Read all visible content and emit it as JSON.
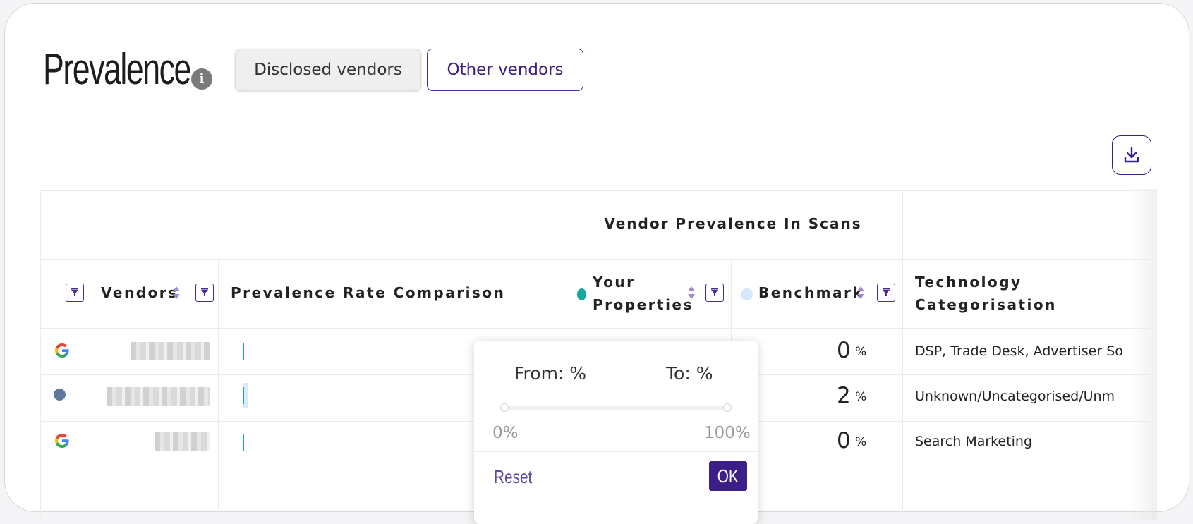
{
  "page": {
    "title": "Prevalence",
    "tabs": [
      {
        "label": "Disclosed vendors",
        "active": false
      },
      {
        "label": "Other vendors",
        "active": true
      }
    ]
  },
  "icons": {
    "info": "info-icon",
    "download": "download-icon",
    "filter": "filter-icon",
    "sort": "sort-icon"
  },
  "colors": {
    "accent": "#3b1e88",
    "your_properties": "#17a89f",
    "benchmark": "#d6e8fb"
  },
  "table": {
    "group_header": "Vendor Prevalence In Scans",
    "columns": {
      "vendors": "Vendors",
      "comparison": "Prevalence Rate Comparison",
      "your_properties": "Your Properties",
      "benchmark": "Benchmark",
      "technology": "Technology Categorisation"
    },
    "rows": [
      {
        "logo": "google-logo",
        "benchmark_value": "0",
        "benchmark_unit": "%",
        "technology": "DSP, Trade Desk, Advertiser So"
      },
      {
        "logo": "dot-logo",
        "benchmark_value": "2",
        "benchmark_unit": "%",
        "technology": "Unknown/Uncategorised/Unm"
      },
      {
        "logo": "google-logo",
        "benchmark_value": "0",
        "benchmark_unit": "%",
        "technology": "Search Marketing"
      }
    ]
  },
  "range_popup": {
    "from_label": "From: %",
    "to_label": "To: %",
    "min_label": "0%",
    "max_label": "100%",
    "from_value": 0,
    "to_value": 100,
    "reset_label": "Reset",
    "ok_label": "OK"
  }
}
